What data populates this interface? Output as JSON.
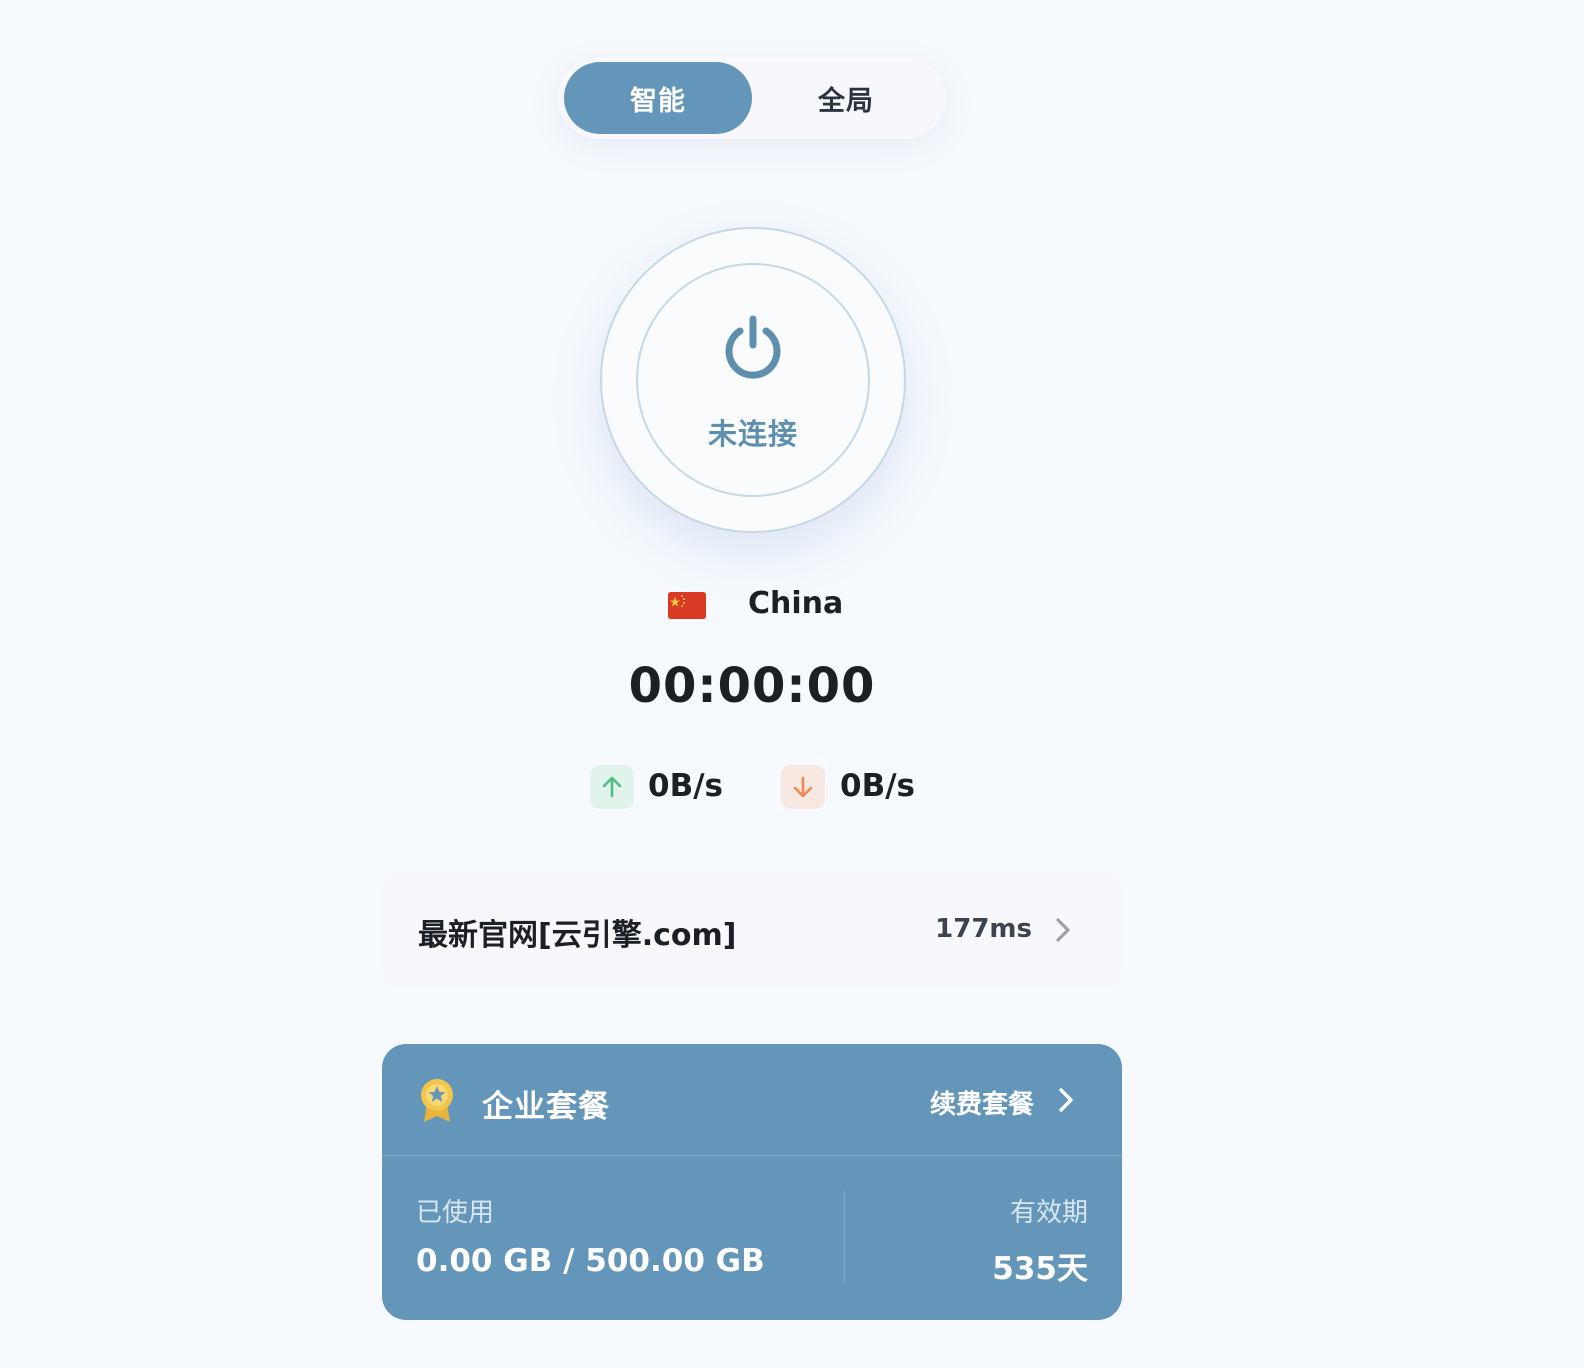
{
  "mode_toggle": {
    "smart_label": "智能",
    "global_label": "全局",
    "active": "smart"
  },
  "power": {
    "status": "未连接"
  },
  "location": {
    "flag": "China flag",
    "country": "China"
  },
  "timer": "00:00:00",
  "speed": {
    "upload": "0B/s",
    "download": "0B/s"
  },
  "server": {
    "name": "最新官网[云引擎.com]",
    "ping": "177ms"
  },
  "plan": {
    "name": "企业套餐",
    "renew_label": "续费套餐",
    "used_label": "已使用",
    "used_value": "0.00 GB / 500.00 GB",
    "expiry_label": "有效期",
    "expiry_value": "535天"
  },
  "colors": {
    "accent": "#6396b8",
    "background": "#f6f9fd",
    "upload": "#4fbf85",
    "download": "#ef8a52",
    "medal": "#f2c54b"
  }
}
